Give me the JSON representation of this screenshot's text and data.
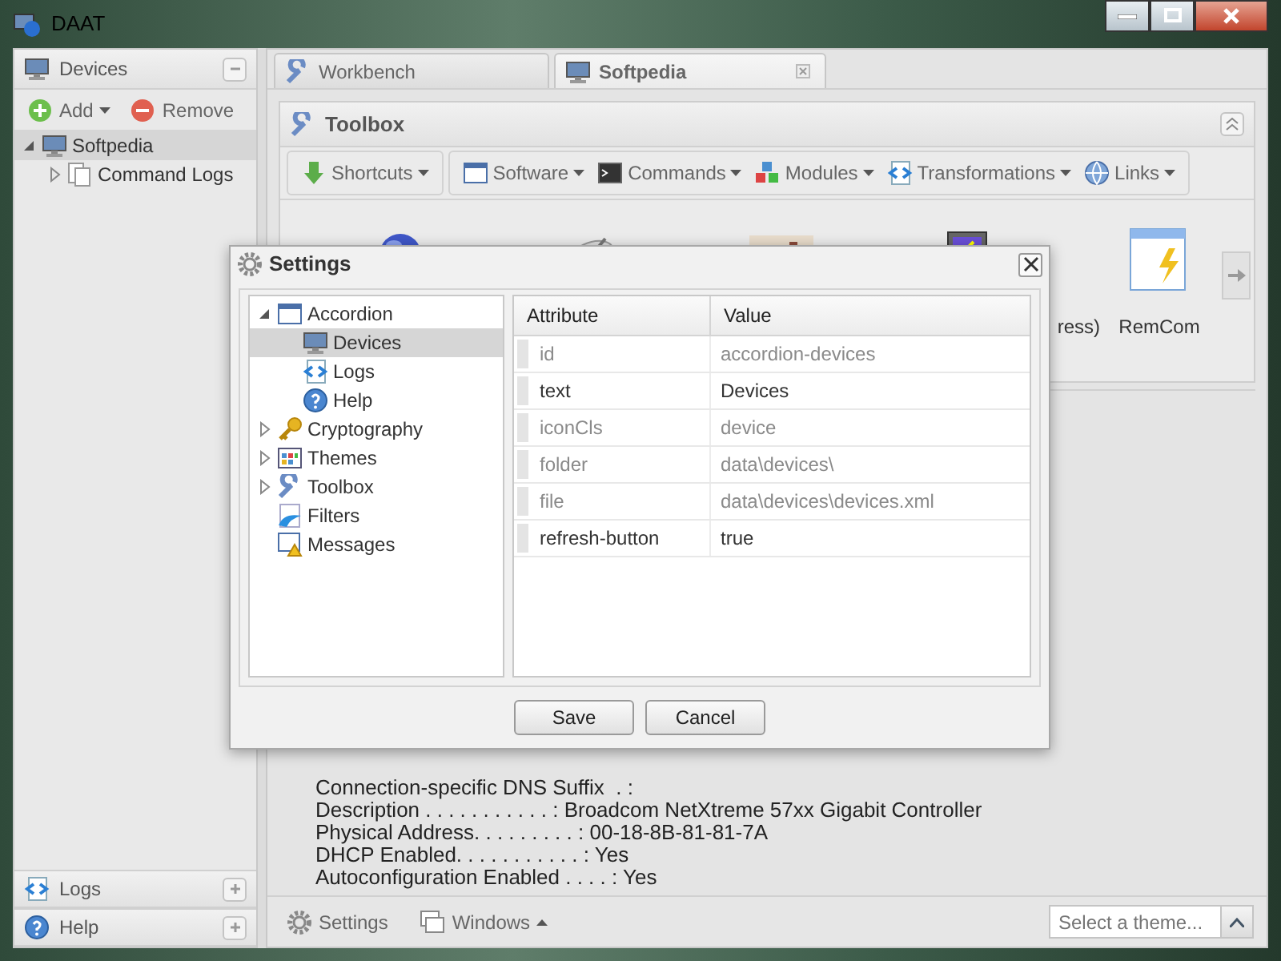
{
  "window": {
    "title": "DAAT"
  },
  "sidebar": {
    "title": "Devices",
    "toolbar": [
      {
        "label": "Add",
        "kind": "add",
        "dropdown": true
      },
      {
        "label": "Remove",
        "kind": "remove",
        "dropdown": false
      }
    ],
    "tree": [
      {
        "label": "Softpedia",
        "kind": "monitor",
        "expandable": true,
        "expanded": true,
        "selected": true,
        "children": [
          {
            "label": "Command Logs",
            "kind": "pages",
            "expandable": true,
            "expanded": false,
            "selected": false
          }
        ]
      }
    ],
    "accordion": [
      {
        "label": "Logs",
        "kind": "code"
      },
      {
        "label": "Help",
        "kind": "help"
      }
    ]
  },
  "tabs": [
    {
      "label": "Workbench",
      "kind": "wrench",
      "selected": false,
      "closable": false
    },
    {
      "label": "Softpedia",
      "kind": "monitor",
      "selected": true,
      "closable": true
    }
  ],
  "toolbox": {
    "title": "Toolbox",
    "menus": [
      {
        "label": "Shortcuts",
        "kind": "down"
      },
      {
        "label": "Software",
        "kind": "window"
      },
      {
        "label": "Commands",
        "kind": "console"
      },
      {
        "label": "Modules",
        "kind": "blocks"
      },
      {
        "label": "Transformations",
        "kind": "code"
      },
      {
        "label": "Links",
        "kind": "globe"
      }
    ],
    "items": [
      {
        "kind": "ball"
      },
      {
        "kind": "dish"
      },
      {
        "kind": "chart"
      },
      {
        "kind": "monitor",
        "label": "ress)"
      },
      {
        "kind": "window",
        "label": "RemCom"
      }
    ]
  },
  "console": {
    "lines": [
      "Connection-specific DNS Suffix  . :",
      "Description . . . . . . . . . . . : Broadcom NetXtreme 57xx Gigabit Controller",
      "Physical Address. . . . . . . . . : 00-18-8B-81-81-7A",
      "DHCP Enabled. . . . . . . . . . . : Yes",
      "Autoconfiguration Enabled . . . . : Yes"
    ]
  },
  "status_bar": {
    "buttons": [
      {
        "label": "Settings",
        "kind": "gear",
        "caret": false
      },
      {
        "label": "Windows",
        "kind": "windows",
        "caret": true
      }
    ],
    "theme": {
      "placeholder": "Select a theme..."
    }
  },
  "dialog": {
    "title": "Settings",
    "tree": [
      {
        "label": "Accordion",
        "kind": "window",
        "expandable": true,
        "expanded": true,
        "selected": false,
        "children": [
          {
            "label": "Devices",
            "kind": "monitor",
            "expandable": false,
            "selected": true
          },
          {
            "label": "Logs",
            "kind": "code",
            "expandable": false,
            "selected": false
          },
          {
            "label": "Help",
            "kind": "help",
            "expandable": false,
            "selected": false
          }
        ]
      },
      {
        "label": "Cryptography",
        "kind": "key",
        "expandable": true,
        "expanded": false,
        "selected": false
      },
      {
        "label": "Themes",
        "kind": "grid",
        "expandable": true,
        "expanded": false,
        "selected": false
      },
      {
        "label": "Toolbox",
        "kind": "wrench",
        "expandable": true,
        "expanded": false,
        "selected": false
      },
      {
        "label": "Filters",
        "kind": "filter",
        "expandable": false,
        "selected": false
      },
      {
        "label": "Messages",
        "kind": "warning",
        "expandable": false,
        "selected": false
      }
    ],
    "grid": {
      "columns": [
        "Attribute",
        "Value"
      ],
      "rows": [
        {
          "attribute": "id",
          "value": "accordion-devices",
          "disabled": true
        },
        {
          "attribute": "text",
          "value": "Devices",
          "disabled": false
        },
        {
          "attribute": "iconCls",
          "value": "device",
          "disabled": true
        },
        {
          "attribute": "folder",
          "value": "data\\devices\\",
          "disabled": true
        },
        {
          "attribute": "file",
          "value": "data\\devices\\devices.xml",
          "disabled": true
        },
        {
          "attribute": "refresh-button",
          "value": "true",
          "disabled": false
        }
      ]
    },
    "buttons": [
      "Save",
      "Cancel"
    ]
  }
}
